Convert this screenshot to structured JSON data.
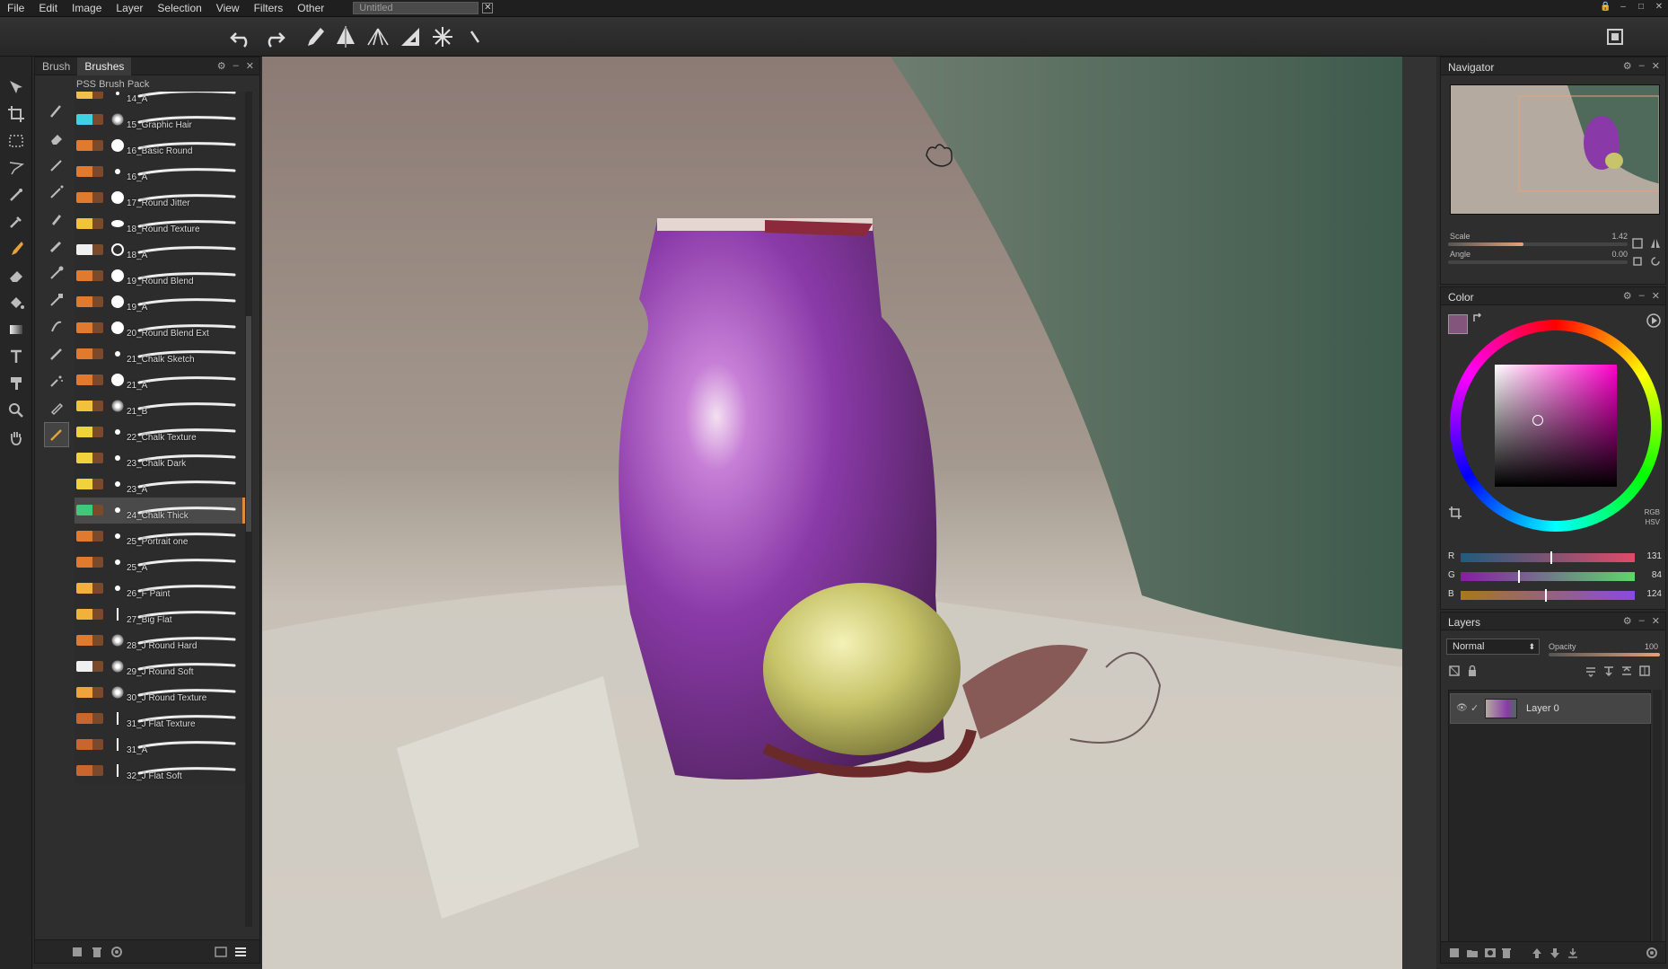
{
  "menu": [
    "File",
    "Edit",
    "Image",
    "Layer",
    "Selection",
    "View",
    "Filters",
    "Other"
  ],
  "document_tab": {
    "title": "Untitled",
    "close": "✕"
  },
  "window_controls": [
    "🔒",
    "–",
    "□",
    "✕"
  ],
  "brush_panel": {
    "tabs": [
      "Brush",
      "Brushes"
    ],
    "active_tab": "Brushes",
    "pack_title": "PSS Brush Pack",
    "selected": "24_Chalk Thick",
    "brushes": [
      {
        "name": "14_A",
        "color": "#f0c14a",
        "tip": "dot"
      },
      {
        "name": "15_Graphic Hair",
        "color": "#3fd2e6",
        "tip": "burst"
      },
      {
        "name": "16_Basic Round",
        "color": "#e07a2e",
        "tip": "circle"
      },
      {
        "name": "16_A",
        "color": "#e07a2e",
        "tip": "small"
      },
      {
        "name": "17_Round Jitter",
        "color": "#e07a2e",
        "tip": "circle"
      },
      {
        "name": "18_Round Texture",
        "color": "#f2c23a",
        "tip": "ellipse"
      },
      {
        "name": "18_A",
        "color": "#f0f0f0",
        "tip": "ring"
      },
      {
        "name": "19_Round Blend",
        "color": "#e07a2e",
        "tip": "circle"
      },
      {
        "name": "19_A",
        "color": "#e07a2e",
        "tip": "circle"
      },
      {
        "name": "20_Round Blend Ext",
        "color": "#e07a2e",
        "tip": "circle"
      },
      {
        "name": "21_Chalk Sketch",
        "color": "#e07a2e",
        "tip": "small"
      },
      {
        "name": "21_A",
        "color": "#e07a2e",
        "tip": "circle"
      },
      {
        "name": "21_B",
        "color": "#f2c23a",
        "tip": "burst"
      },
      {
        "name": "22_Chalk Texture",
        "color": "#f2d23a",
        "tip": "small"
      },
      {
        "name": "23_Chalk Dark",
        "color": "#f2d23a",
        "tip": "small"
      },
      {
        "name": "23_A",
        "color": "#f2d23a",
        "tip": "small"
      },
      {
        "name": "24_Chalk Thick",
        "color": "#3fc77a",
        "tip": "small"
      },
      {
        "name": "25_Portrait one",
        "color": "#e07a2e",
        "tip": "small"
      },
      {
        "name": "25_A",
        "color": "#e07a2e",
        "tip": "small"
      },
      {
        "name": "26_F Paint",
        "color": "#f2b23a",
        "tip": "small"
      },
      {
        "name": "27_Big Flat",
        "color": "#f2b23a",
        "tip": "line"
      },
      {
        "name": "28_J Round Hard",
        "color": "#e07a2e",
        "tip": "burst"
      },
      {
        "name": "29_J Round Soft",
        "color": "#f0f0f0",
        "tip": "burst"
      },
      {
        "name": "30_J Round Texture",
        "color": "#f2a23a",
        "tip": "burst"
      },
      {
        "name": "31_J Flat Texture",
        "color": "#c8662e",
        "tip": "line"
      },
      {
        "name": "31_A",
        "color": "#c8662e",
        "tip": "line"
      },
      {
        "name": "32_J Flat Soft",
        "color": "#c8662e",
        "tip": "line"
      }
    ]
  },
  "navigator": {
    "title": "Navigator",
    "scale_label": "Scale",
    "scale_value": "1.42",
    "scale_fraction": 0.42,
    "angle_label": "Angle",
    "angle_value": "0.00",
    "angle_fraction": 0.0
  },
  "color": {
    "title": "Color",
    "swatch": "#83547c",
    "mode_rgb": "RGB",
    "mode_hsv": "HSV",
    "r_label": "R",
    "r_value": "131",
    "g_label": "G",
    "g_value": "84",
    "b_label": "B",
    "b_value": "124"
  },
  "layers": {
    "title": "Layers",
    "blend_mode": "Normal",
    "opacity_label": "Opacity",
    "opacity_value": "100",
    "layer_name": "Layer 0"
  }
}
